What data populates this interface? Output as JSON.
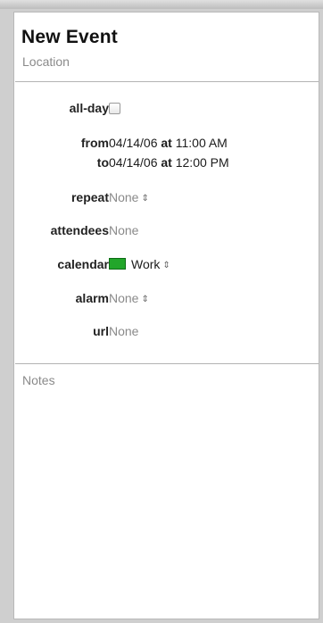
{
  "title": "New Event",
  "location_placeholder": "Location",
  "fields": {
    "allday_label": "all-day",
    "from_label": "from",
    "from_date": "04/14/06",
    "from_at": "at",
    "from_time": "11:00 AM",
    "to_label": "to",
    "to_date": "04/14/06",
    "to_at": "at",
    "to_time": "12:00 PM",
    "repeat_label": "repeat",
    "repeat_value": "None",
    "attendees_label": "attendees",
    "attendees_value": "None",
    "calendar_label": "calendar",
    "calendar_value": "Work",
    "calendar_color": "#22a62a",
    "alarm_label": "alarm",
    "alarm_value": "None",
    "url_label": "url",
    "url_value": "None"
  },
  "notes_placeholder": "Notes"
}
